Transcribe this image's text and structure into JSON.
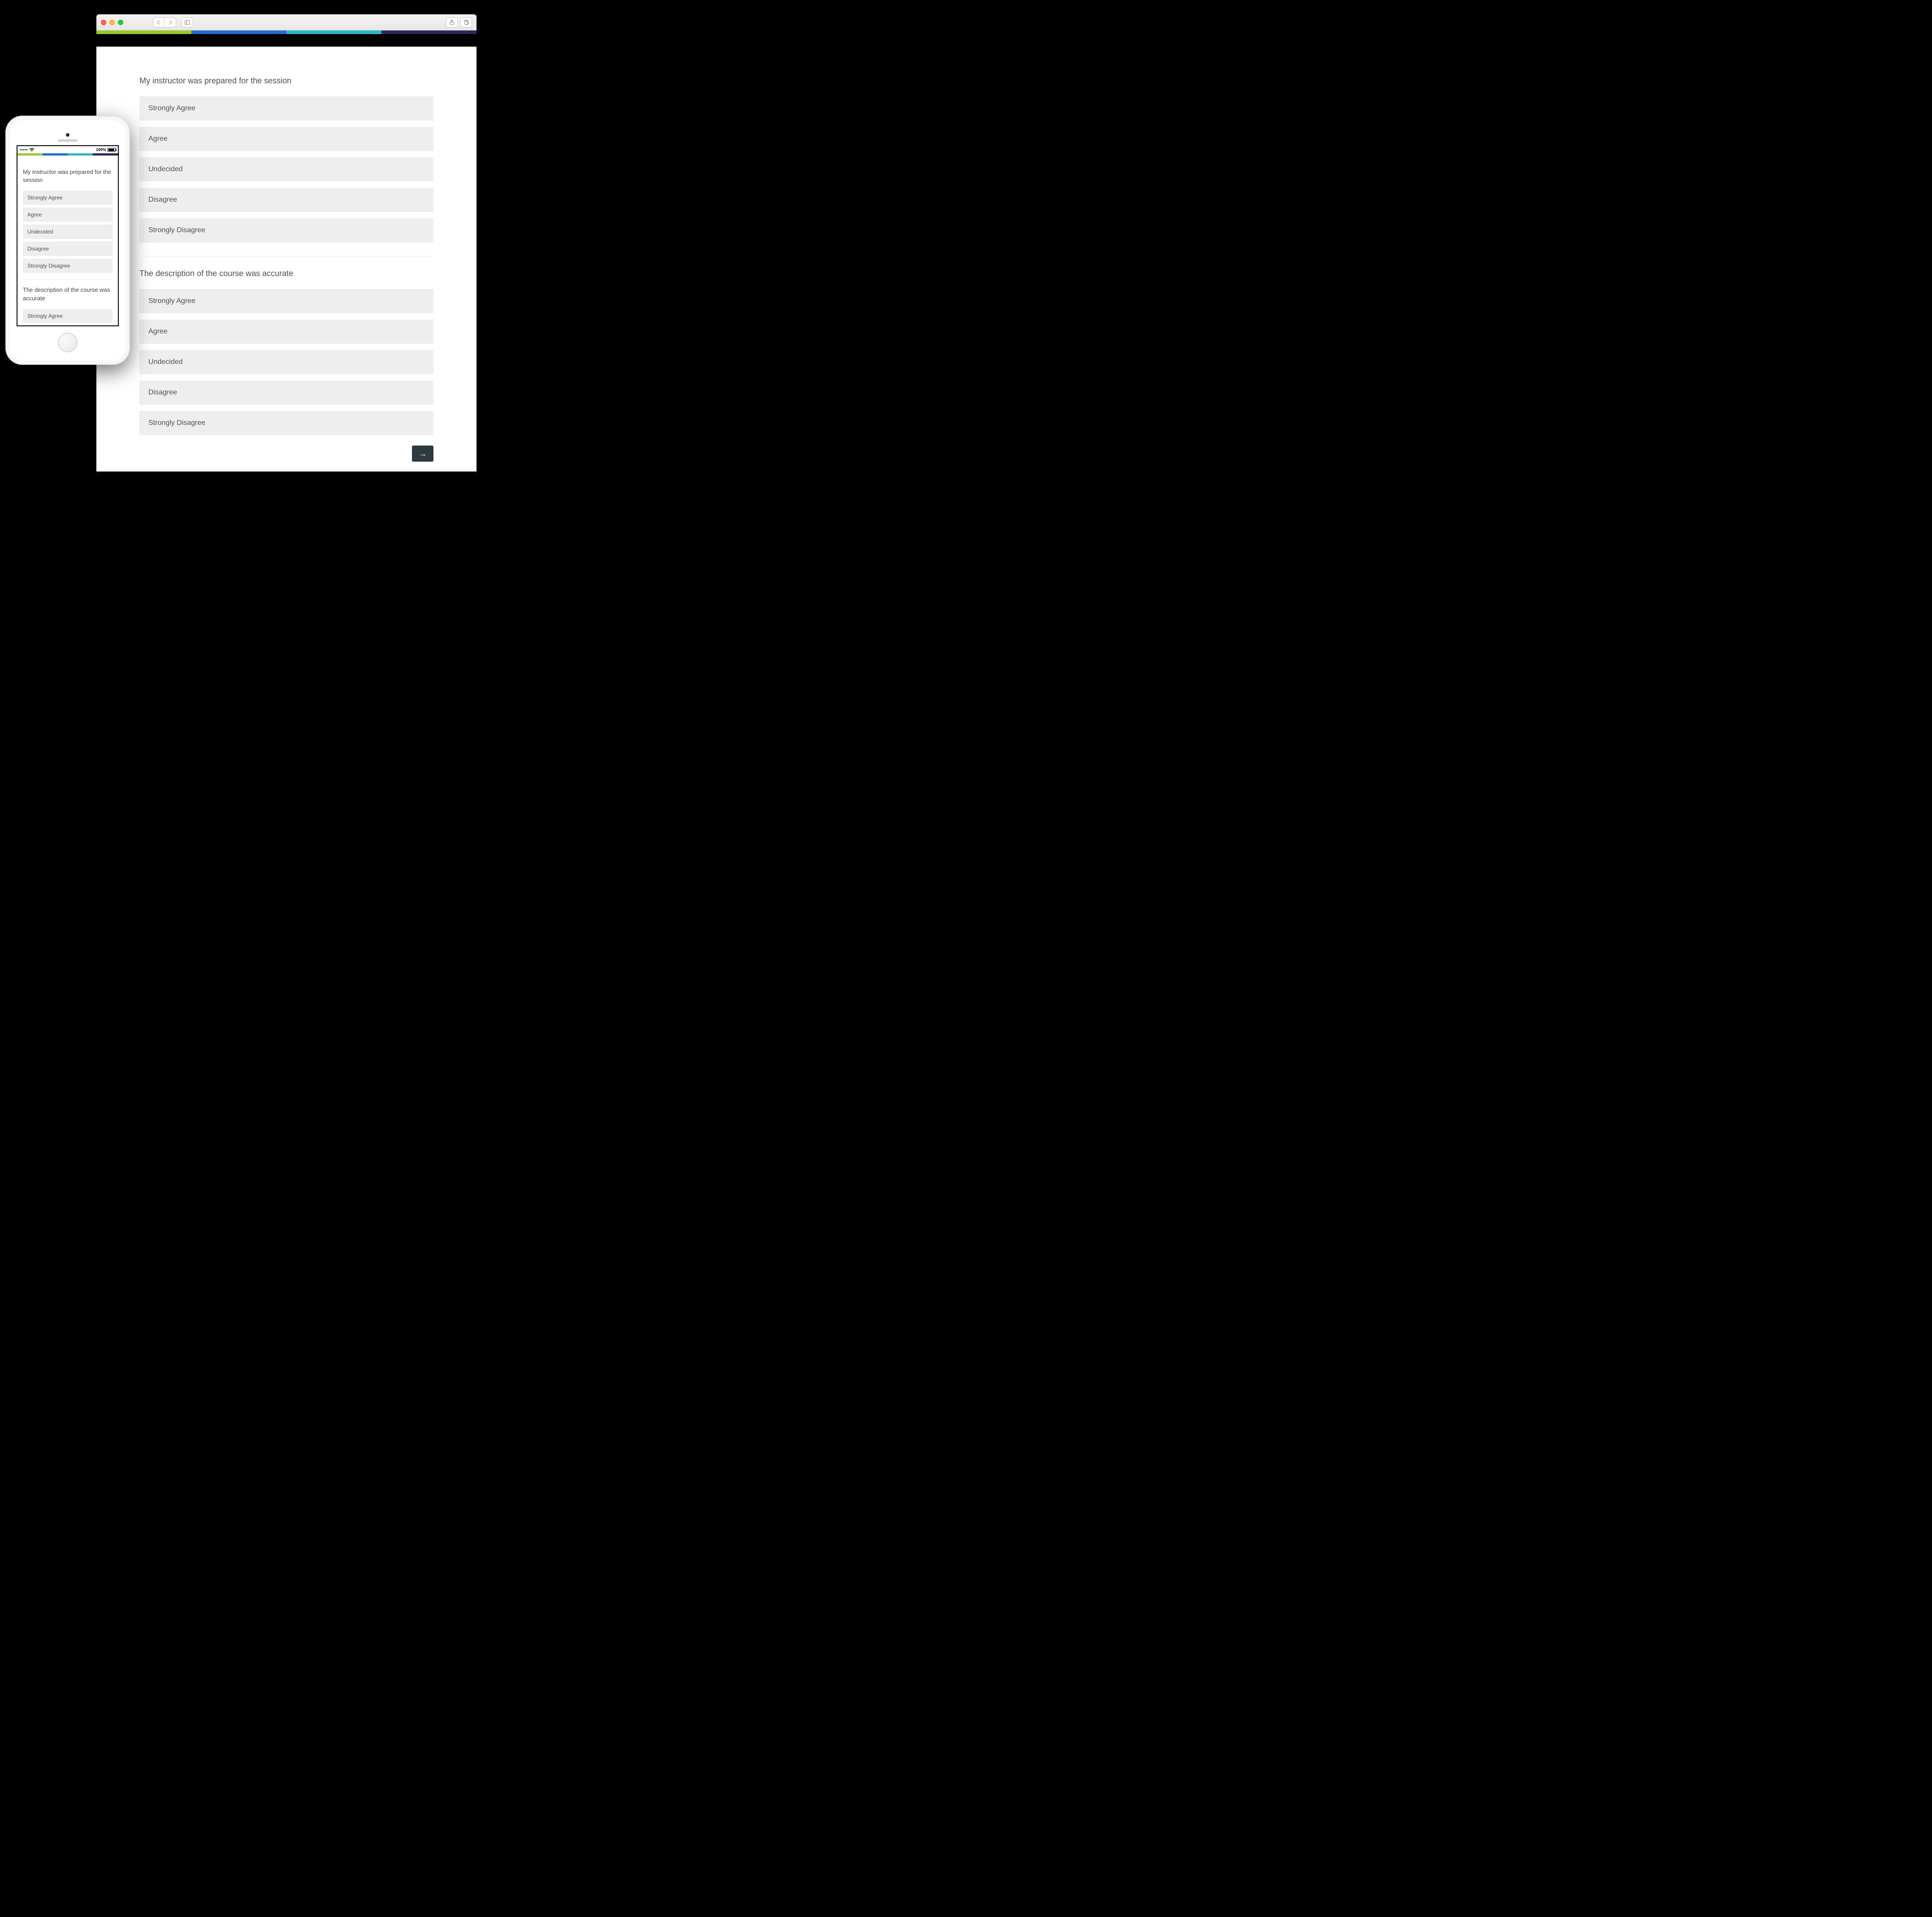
{
  "colors": {
    "accent_green": "#9ac92e",
    "accent_blue": "#1f6fd0",
    "accent_teal": "#2ab7c4",
    "accent_navy": "#2c2a59"
  },
  "desktop": {
    "survey": {
      "questions": [
        {
          "title": "My instructor was prepared for the session",
          "options": [
            "Strongly Agree",
            "Agree",
            "Undecided",
            "Disagree",
            "Strongly Disagree"
          ]
        },
        {
          "title": "The description of the course was accurate",
          "options": [
            "Strongly Agree",
            "Agree",
            "Undecided",
            "Disagree",
            "Strongly Disagree"
          ]
        }
      ]
    },
    "next_icon": "→"
  },
  "mobile": {
    "status": {
      "signal_text": "•••••",
      "wifi_icon": "wifi",
      "battery_text": "100%"
    },
    "survey": {
      "questions": [
        {
          "title": "My instructor was prepared for the session",
          "options": [
            "Strongly Agree",
            "Agree",
            "Undecided",
            "Disagree",
            "Strongly Disagree"
          ]
        },
        {
          "title": "The description of the course was accurate",
          "options": [
            "Strongly Agree"
          ]
        }
      ]
    }
  }
}
